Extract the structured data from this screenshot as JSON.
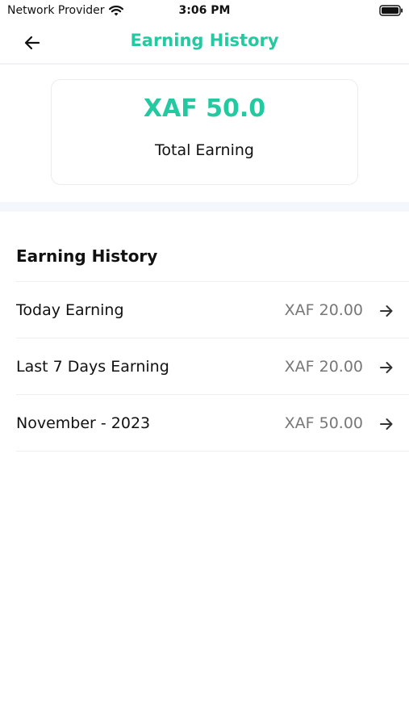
{
  "status_bar": {
    "carrier": "Network Provider",
    "time": "3:06 PM",
    "wifi_icon": "wifi-icon",
    "battery_icon": "battery-icon"
  },
  "app_bar": {
    "title": "Earning History",
    "back_icon": "arrow-left-icon"
  },
  "summary": {
    "amount": "XAF 50.0",
    "label": "Total Earning"
  },
  "history": {
    "title": "Earning History",
    "items": [
      {
        "label": "Today Earning",
        "amount": "XAF 20.00",
        "icon": "arrow-right-icon"
      },
      {
        "label": "Last 7 Days Earning",
        "amount": "XAF 20.00",
        "icon": "arrow-right-icon"
      },
      {
        "label": "November - 2023",
        "amount": "XAF 50.00",
        "icon": "arrow-right-icon"
      }
    ]
  },
  "colors": {
    "accent": "#23c9a0",
    "muted_text": "#777777",
    "section_divider": "#f4f7fc"
  }
}
